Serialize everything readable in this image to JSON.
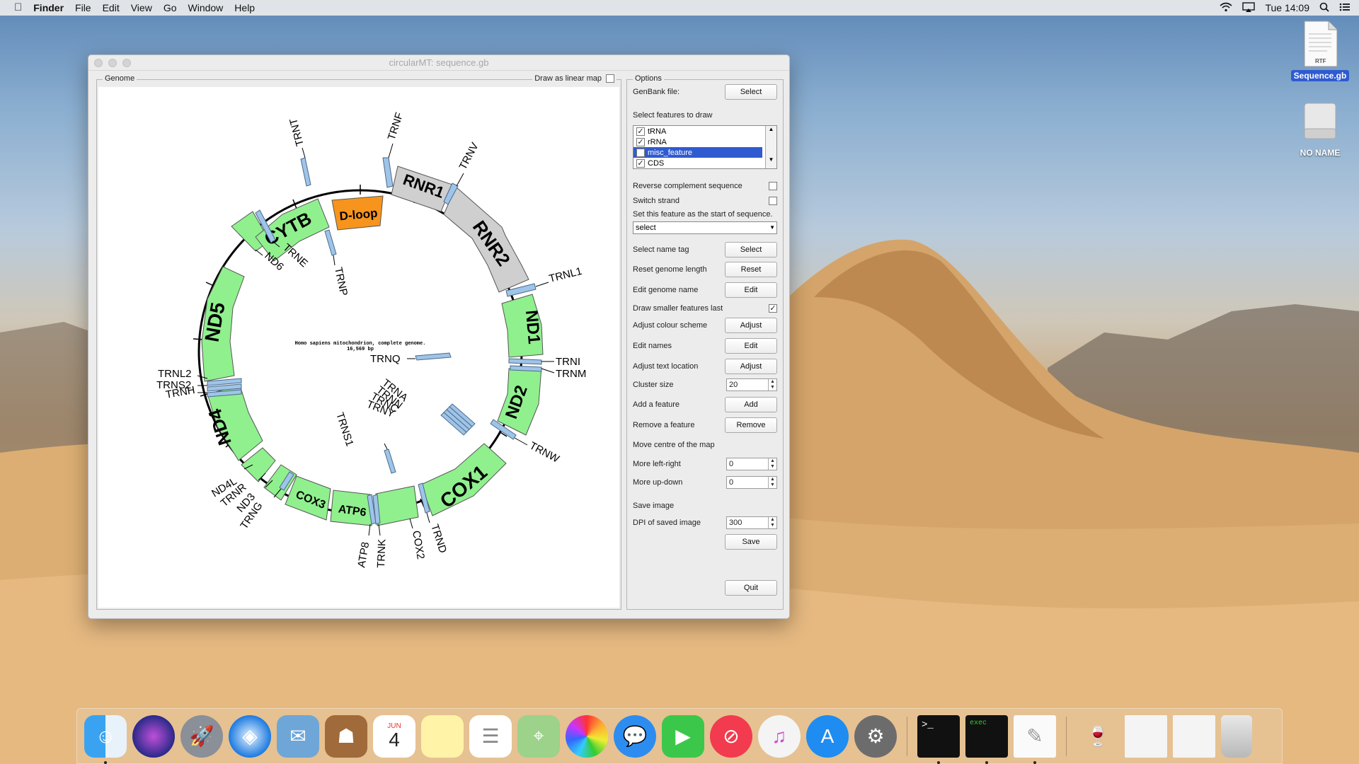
{
  "menubar": {
    "apple": "",
    "app": "Finder",
    "items": [
      "File",
      "Edit",
      "View",
      "Go",
      "Window",
      "Help"
    ],
    "clock": "Tue 14:09"
  },
  "desktop": {
    "file_label": "Sequence.gb",
    "file_badge": "RTF",
    "drive_label": "NO NAME"
  },
  "window": {
    "title": "circularMT: sequence.gb"
  },
  "genome_panel": {
    "label": "Genome",
    "linear_map_label": "Draw as linear map",
    "linear_map_checked": false
  },
  "map": {
    "center_title": "Homo sapiens mitochondrion, complete genome.",
    "center_length": "16,569 bp",
    "features": [
      {
        "name": "D-loop",
        "color": "#f7941d",
        "label_color": "#000"
      },
      {
        "name": "RNR1",
        "color": "#cfcfcf"
      },
      {
        "name": "RNR2",
        "color": "#cfcfcf"
      },
      {
        "name": "ND1",
        "color": "#90f08e"
      },
      {
        "name": "ND2",
        "color": "#90f08e"
      },
      {
        "name": "COX1",
        "color": "#90f08e"
      },
      {
        "name": "COX2",
        "color": "#90f08e"
      },
      {
        "name": "ATP6",
        "color": "#90f08e"
      },
      {
        "name": "COX3",
        "color": "#90f08e"
      },
      {
        "name": "ND4",
        "color": "#90f08e"
      },
      {
        "name": "ND5",
        "color": "#90f08e"
      },
      {
        "name": "CYTB",
        "color": "#90f08e"
      },
      {
        "name": "ND6",
        "color": "#90f08e"
      }
    ],
    "trna_labels": [
      "TRNF",
      "TRNV",
      "TRNL1",
      "TRNI",
      "TRNM",
      "TRNQ",
      "TRNW",
      "TRNA",
      "TRNN",
      "TRNC",
      "TRNY",
      "TRNS1",
      "TRND",
      "COX2",
      "TRNK",
      "ATP8",
      "TRNG",
      "ND3",
      "TRNR",
      "ND4L",
      "TRNH",
      "TRNS2",
      "TRNL2",
      "TRNE",
      "ND6",
      "TRNP",
      "TRNT"
    ]
  },
  "options": {
    "label": "Options",
    "genbank_label": "GenBank file:",
    "genbank_btn": "Select",
    "select_features_label": "Select features to draw",
    "feature_list": [
      {
        "name": "tRNA",
        "checked": true
      },
      {
        "name": "rRNA",
        "checked": true
      },
      {
        "name": "misc_feature",
        "checked": false
      },
      {
        "name": "CDS",
        "checked": true
      }
    ],
    "reverse_label": "Reverse complement sequence",
    "switch_label": "Switch strand",
    "start_label": "Set this feature as the start of sequence.",
    "start_value": "select",
    "name_tag_label": "Select name tag",
    "name_tag_btn": "Select",
    "reset_len_label": "Reset genome length",
    "reset_len_btn": "Reset",
    "edit_name_label": "Edit genome name",
    "edit_name_btn": "Edit",
    "smaller_last_label": "Draw smaller features last",
    "colour_label": "Adjust colour scheme",
    "colour_btn": "Adjust",
    "edit_names_label": "Edit names",
    "edit_names_btn": "Edit",
    "text_loc_label": "Adjust text location",
    "text_loc_btn": "Adjust",
    "cluster_label": "Cluster size",
    "cluster_value": "20",
    "add_label": "Add a feature",
    "add_btn": "Add",
    "remove_label": "Remove a feature",
    "remove_btn": "Remove",
    "move_label": "Move centre of the map",
    "lr_label": "More left-right",
    "lr_value": "0",
    "ud_label": "More up-down",
    "ud_value": "0",
    "save_image_label": "Save image",
    "dpi_label": "DPI of saved image",
    "dpi_value": "300",
    "save_btn": "Save",
    "quit_btn": "Quit"
  },
  "dock": {
    "apps": [
      "Finder",
      "Siri",
      "Launchpad",
      "Safari",
      "Mail",
      "Contacts",
      "Calendar",
      "Notes",
      "Reminders",
      "Maps",
      "Photos",
      "Messages",
      "FaceTime",
      "News",
      "iTunes",
      "App Store",
      "System Preferences",
      "Terminal",
      "Exec",
      "TextEdit",
      "Wine",
      "Document 1",
      "Document 2",
      "Trash"
    ],
    "calendar_month": "JUN",
    "calendar_day": "4"
  }
}
